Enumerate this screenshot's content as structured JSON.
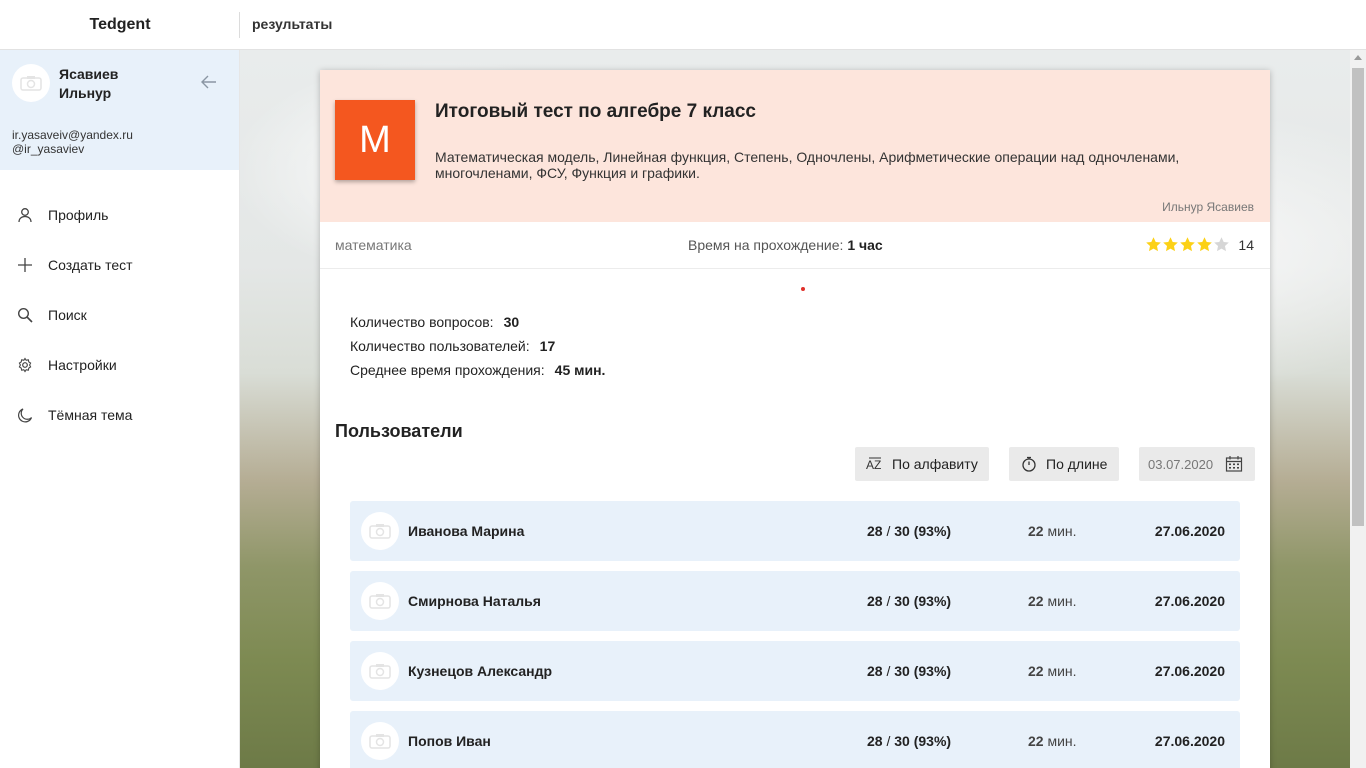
{
  "app": {
    "name": "Tedgent",
    "page_title": "результаты"
  },
  "sidebar": {
    "user": {
      "name": "Ясавиев Ильнур",
      "email": "ir.yasaveiv@yandex.ru",
      "handle": "@ir_yasaviev"
    },
    "items": [
      {
        "label": "Профиль",
        "icon": "user-icon"
      },
      {
        "label": "Создать тест",
        "icon": "plus-icon"
      },
      {
        "label": "Поиск",
        "icon": "search-icon"
      },
      {
        "label": "Настройки",
        "icon": "gear-icon"
      },
      {
        "label": "Тёмная тема",
        "icon": "moon-icon"
      }
    ]
  },
  "test": {
    "logo_letter": "M",
    "logo_color": "#f4571f",
    "title": "Итоговый тест по алгебре 7 класс",
    "description": "Математическая модель, Линейная функция, Степень, Одночлены, Арифметические операции над одночленами, многочленами, ФСУ, Функция и графики.",
    "author": "Ильнур Ясавиев",
    "subject": "математика",
    "time_label": "Время на прохождение:",
    "time_value": "1 час",
    "rating_stars": 4,
    "rating_max": 5,
    "rating_count": "14"
  },
  "stats": [
    {
      "label": "Количество вопросов:",
      "value": "30"
    },
    {
      "label": "Количество пользователей:",
      "value": "17"
    },
    {
      "label": "Среднее время прохождения:",
      "value": "45 мин."
    }
  ],
  "users_section": {
    "heading": "Пользователи",
    "sort_alpha_label": "По алфавиту",
    "sort_length_label": "По длине",
    "date_value": "03.07.2020"
  },
  "users": [
    {
      "name": "Иванова Марина",
      "score": "28",
      "total": "30",
      "percent": "(93%)",
      "time": "22",
      "time_unit": "мин.",
      "date": "27.06.2020"
    },
    {
      "name": "Смирнова Наталья",
      "score": "28",
      "total": "30",
      "percent": "(93%)",
      "time": "22",
      "time_unit": "мин.",
      "date": "27.06.2020"
    },
    {
      "name": "Кузнецов Александр",
      "score": "28",
      "total": "30",
      "percent": "(93%)",
      "time": "22",
      "time_unit": "мин.",
      "date": "27.06.2020"
    },
    {
      "name": "Попов Иван",
      "score": "28",
      "total": "30",
      "percent": "(93%)",
      "time": "22",
      "time_unit": "мин.",
      "date": "27.06.2020"
    }
  ],
  "colors": {
    "accent": "#f4571f",
    "header_bg": "#fde5dc",
    "row_bg": "#e8f1fa",
    "star": "#fcd116"
  }
}
